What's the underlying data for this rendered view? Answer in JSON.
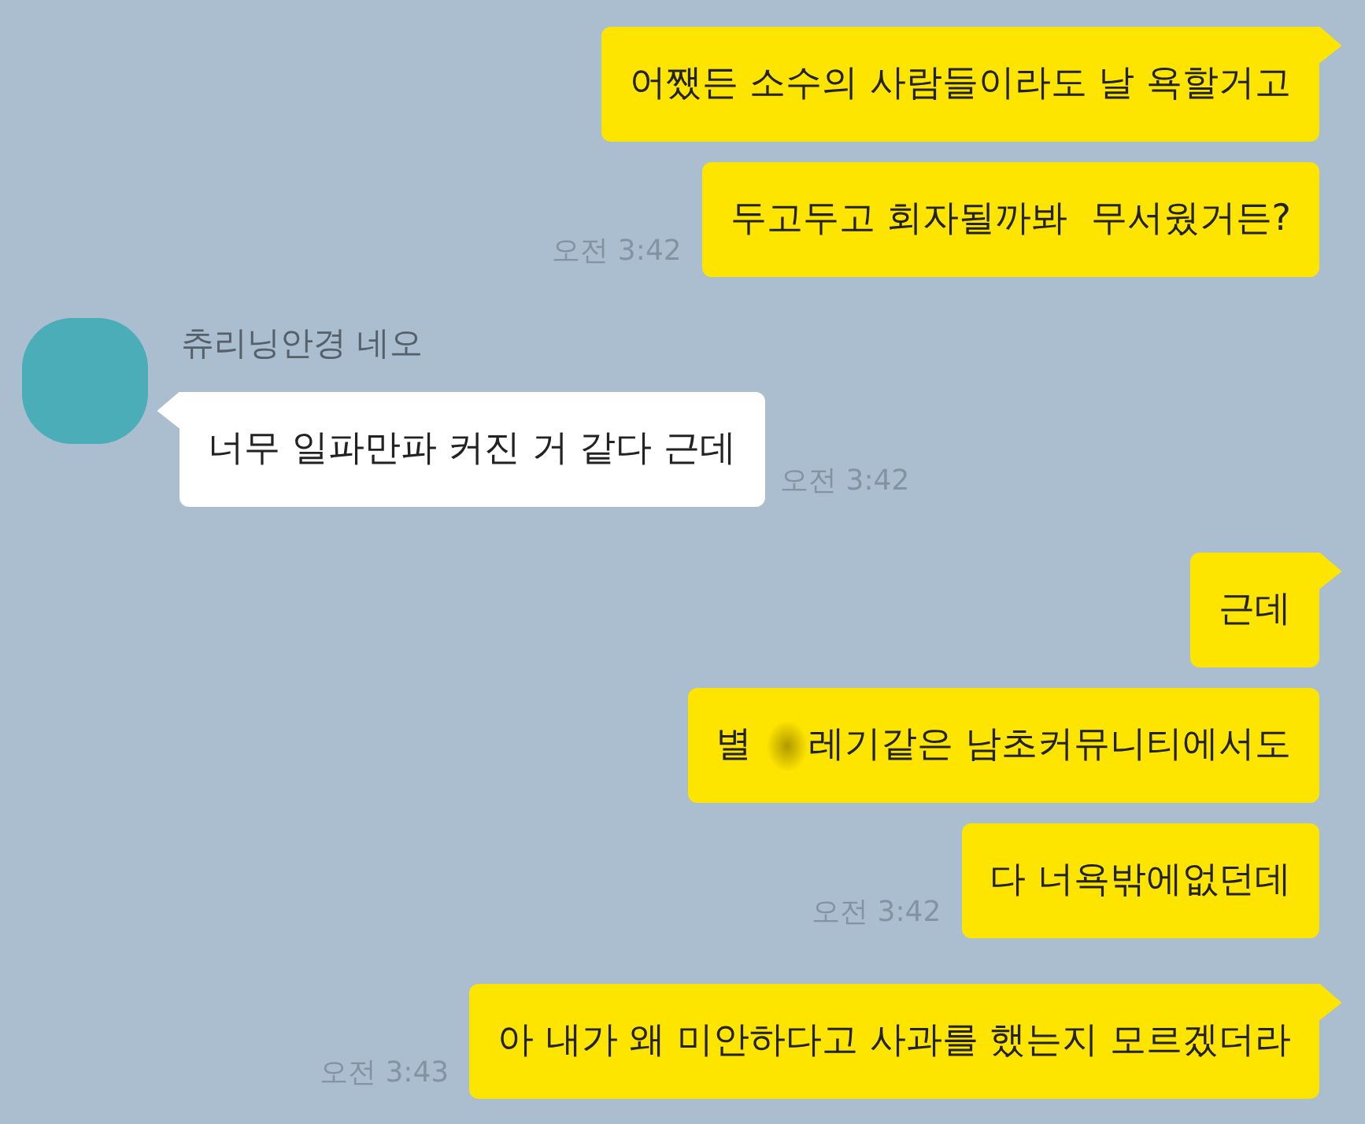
{
  "messages": [
    {
      "kind": "sent",
      "tail": true,
      "text": "어쨌든 소수의 사람들이라도 날 욕할거고"
    },
    {
      "kind": "sent",
      "tail": false,
      "text": "두고두고 회자될까봐  무서웠거든?",
      "time": "오전 3:42"
    },
    {
      "kind": "received",
      "tail": true,
      "sender": "츄리닝안경 네오",
      "text": "너무 일파만파 커진 거 같다 근데",
      "time": "오전 3:42"
    },
    {
      "kind": "sent",
      "tail": true,
      "text": "근데"
    },
    {
      "kind": "sent",
      "tail": false,
      "segments": [
        {
          "kind": "text",
          "text": "별"
        },
        {
          "kind": "blur"
        },
        {
          "kind": "text",
          "text": "레기같은 남초커뮤니티에서도"
        }
      ]
    },
    {
      "kind": "sent",
      "tail": false,
      "text": "다 너욕밖에없던데",
      "time": "오전 3:42"
    },
    {
      "kind": "sent",
      "tail": true,
      "text": "아 내가 왜 미안하다고 사과를 했는지 모르겠더라",
      "time": "오전 3:43"
    }
  ]
}
